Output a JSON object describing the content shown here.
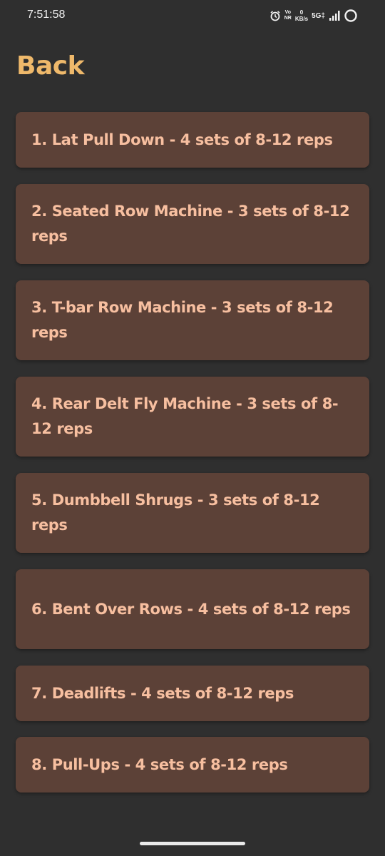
{
  "status_bar": {
    "time": "7:51:58",
    "vonr_top": "Vo",
    "vonr_bottom": "NR",
    "net_speed_value": "0",
    "net_speed_unit": "KB/s",
    "network_type": "5G‡",
    "icons": [
      "alarm-icon",
      "signal-icon",
      "battery-icon"
    ]
  },
  "header": {
    "back_label": "Back"
  },
  "exercises": [
    "1. Lat Pull Down - 4 sets of 8-12 reps",
    "2. Seated Row Machine - 3 sets of 8-12 reps",
    "3. T-bar Row Machine - 3 sets of 8-12 reps",
    "4. Rear Delt Fly Machine - 3 sets of 8-12 reps",
    "5. Dumbbell Shrugs - 3 sets of 8-12 reps",
    "6. Bent Over Rows - 4 sets of 8-12 reps",
    "7. Deadlifts - 4 sets of 8-12 reps",
    "8. Pull-Ups - 4 sets of 8-12 reps"
  ],
  "colors": {
    "background": "#2f2f2f",
    "back_accent": "#efb96b",
    "card": "#5c4137",
    "card_text": "#f7bfa0"
  }
}
